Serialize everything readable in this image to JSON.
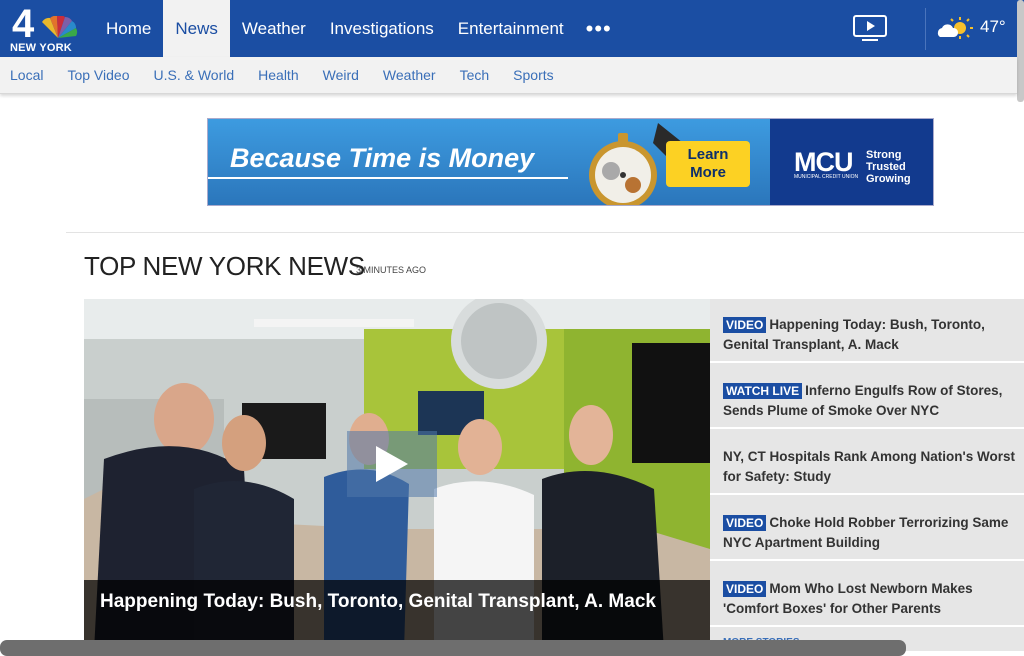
{
  "brand": {
    "logo_number": "4",
    "logo_city": "NEW YORK"
  },
  "main_nav": [
    {
      "label": "Home",
      "active": false
    },
    {
      "label": "News",
      "active": true
    },
    {
      "label": "Weather",
      "active": false
    },
    {
      "label": "Investigations",
      "active": false
    },
    {
      "label": "Entertainment",
      "active": false
    }
  ],
  "more_icon": "ellipsis-icon",
  "weather": {
    "temp": "47°",
    "icon": "partly-cloudy-icon"
  },
  "sub_nav": [
    "Local",
    "Top Video",
    "U.S. & World",
    "Health",
    "Weird",
    "Weather",
    "Tech",
    "Sports"
  ],
  "ad": {
    "slogan": "Because Time is Money",
    "cta_line1": "Learn",
    "cta_line2": "More",
    "brand": "MCU",
    "brand_sub": "MUNICIPAL CREDIT UNION",
    "tag1": "Strong",
    "tag2": "Trusted",
    "tag3": "Growing"
  },
  "section": {
    "title": "TOP NEW YORK NEWS",
    "updated": "3 MINUTES AGO"
  },
  "hero": {
    "caption": "Happening Today: Bush, Toronto, Genital Transplant, A. Mack"
  },
  "stories": [
    {
      "badge": "VIDEO",
      "text": "Happening Today: Bush, Toronto, Genital Transplant, A. Mack"
    },
    {
      "badge": "WATCH LIVE",
      "text": "Inferno Engulfs Row of Stores, Sends Plume of Smoke Over NYC"
    },
    {
      "badge": "",
      "text": "NY, CT Hospitals Rank Among Nation's Worst for Safety: Study"
    },
    {
      "badge": "VIDEO",
      "text": "Choke Hold Robber Terrorizing Same NYC Apartment Building"
    },
    {
      "badge": "VIDEO",
      "text": "Mom Who Lost Newborn Makes 'Comfort Boxes' for Other Parents"
    }
  ],
  "more_stories": "MORE STORIES »",
  "colors": {
    "brand_blue": "#1b4ea3",
    "link_blue": "#3a6fb8",
    "ad_yellow": "#fcd123"
  }
}
